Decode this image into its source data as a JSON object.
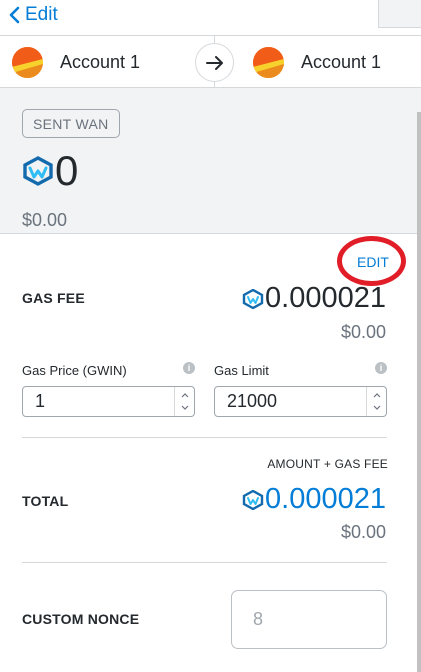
{
  "header": {
    "back_label": "Edit",
    "back_icon": "chevron-left-icon",
    "accent_color": "#037dd6"
  },
  "accounts": {
    "from_name": "Account 1",
    "to_name": "Account 1",
    "arrow_icon": "arrow-right-icon"
  },
  "summary": {
    "action": "SENT WAN",
    "token_icon": "wanchain-logo-icon",
    "amount": "0",
    "fiat": "$0.00"
  },
  "details": {
    "edit_label": "EDIT",
    "annotation_color": "#e11d27",
    "gas_fee_label": "GAS FEE",
    "gas_fee_amount": "0.000021",
    "gas_fee_fiat": "$0.00",
    "gas_price_label": "Gas Price (GWIN)",
    "gas_price_value": "1",
    "gas_limit_label": "Gas Limit",
    "gas_limit_value": "21000",
    "info_glyph": "i",
    "amount_plus_gas_label": "AMOUNT + GAS FEE",
    "total_label": "TOTAL",
    "total_amount": "0.000021",
    "total_fiat": "$0.00",
    "custom_nonce_label": "CUSTOM NONCE",
    "custom_nonce_placeholder": "8"
  }
}
